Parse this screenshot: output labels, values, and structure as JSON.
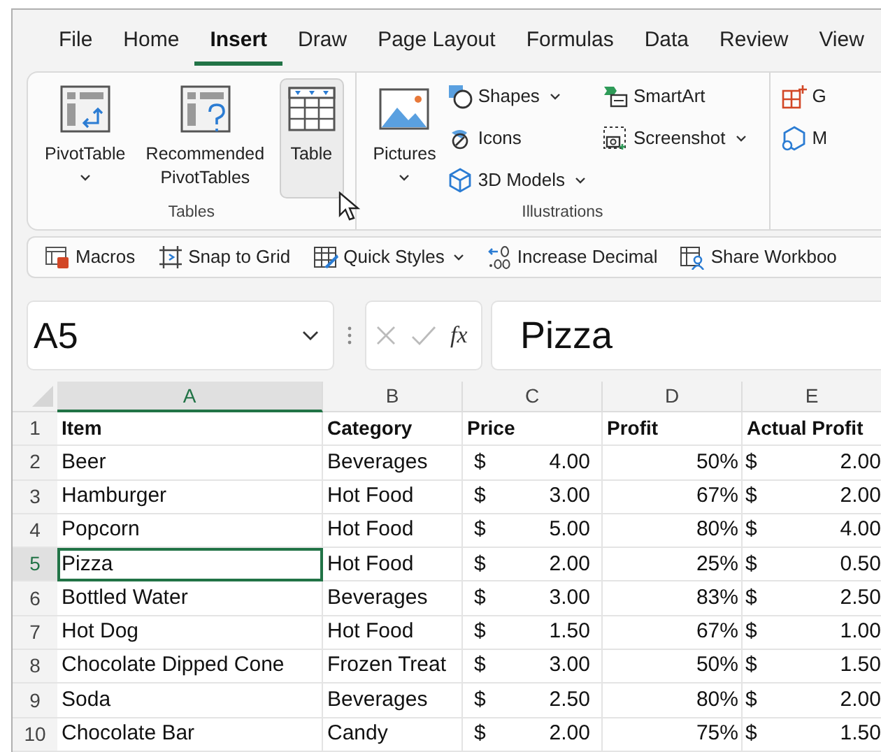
{
  "tabs": [
    {
      "label": "File",
      "selected": false
    },
    {
      "label": "Home",
      "selected": false
    },
    {
      "label": "Insert",
      "selected": true
    },
    {
      "label": "Draw",
      "selected": false
    },
    {
      "label": "Page Layout",
      "selected": false
    },
    {
      "label": "Formulas",
      "selected": false
    },
    {
      "label": "Data",
      "selected": false
    },
    {
      "label": "Review",
      "selected": false
    },
    {
      "label": "View",
      "selected": false
    }
  ],
  "ribbon": {
    "groups": [
      {
        "label": "Tables",
        "items": [
          {
            "kind": "large",
            "label": "PivotTable",
            "dropdown": true,
            "highlighted": false
          },
          {
            "kind": "large",
            "label": "Recommended PivotTables",
            "dropdown": false,
            "highlighted": false
          },
          {
            "kind": "large",
            "label": "Table",
            "dropdown": false,
            "highlighted": true
          }
        ]
      },
      {
        "label": "Illustrations",
        "items": [
          {
            "kind": "large",
            "label": "Pictures",
            "dropdown": true,
            "highlighted": false
          },
          {
            "kind": "stack",
            "items": [
              {
                "label": "Shapes",
                "dropdown": true
              },
              {
                "label": "Icons",
                "dropdown": false
              },
              {
                "label": "3D Models",
                "dropdown": true
              }
            ]
          },
          {
            "kind": "stack",
            "items": [
              {
                "label": "SmartArt",
                "dropdown": false
              },
              {
                "label": "Screenshot",
                "dropdown": true
              }
            ]
          }
        ]
      },
      {
        "items": [
          {
            "kind": "stack",
            "items": [
              {
                "label": "G",
                "dropdown": false
              },
              {
                "label": "M",
                "dropdown": false
              }
            ]
          }
        ]
      }
    ]
  },
  "quick_toolbar": [
    {
      "label": "Macros",
      "dropdown": false
    },
    {
      "label": "Snap to Grid",
      "dropdown": false
    },
    {
      "label": "Quick Styles",
      "dropdown": true
    },
    {
      "label": "Increase Decimal",
      "dropdown": false
    },
    {
      "label": "Share Workboo",
      "dropdown": false
    }
  ],
  "formula_bar": {
    "name_box": "A5",
    "function_label": "fx",
    "value": "Pizza"
  },
  "sheet": {
    "columns": [
      {
        "label": "A",
        "selected": true
      },
      {
        "label": "B",
        "selected": false
      },
      {
        "label": "C",
        "selected": false
      },
      {
        "label": "D",
        "selected": false
      },
      {
        "label": "E",
        "selected": false
      }
    ],
    "rows": [
      {
        "number": "1",
        "kind": "header",
        "selected": false,
        "cells": [
          "Item",
          "Category",
          "Price",
          "Profit",
          "Actual Profit"
        ]
      },
      {
        "number": "2",
        "kind": "data",
        "selected": false,
        "item": "Beer",
        "category": "Beverages",
        "price": {
          "currency": "$",
          "amount": "4.00"
        },
        "profit": "50%",
        "actual_profit": {
          "currency": "$",
          "amount": "2.00"
        }
      },
      {
        "number": "3",
        "kind": "data",
        "selected": false,
        "item": "Hamburger",
        "category": "Hot Food",
        "price": {
          "currency": "$",
          "amount": "3.00"
        },
        "profit": "67%",
        "actual_profit": {
          "currency": "$",
          "amount": "2.00"
        }
      },
      {
        "number": "4",
        "kind": "data",
        "selected": false,
        "item": "Popcorn",
        "category": "Hot Food",
        "price": {
          "currency": "$",
          "amount": "5.00"
        },
        "profit": "80%",
        "actual_profit": {
          "currency": "$",
          "amount": "4.00"
        }
      },
      {
        "number": "5",
        "kind": "data",
        "selected": true,
        "item": "Pizza",
        "category": "Hot Food",
        "price": {
          "currency": "$",
          "amount": "2.00"
        },
        "profit": "25%",
        "actual_profit": {
          "currency": "$",
          "amount": "0.50"
        }
      },
      {
        "number": "6",
        "kind": "data",
        "selected": false,
        "item": "Bottled Water",
        "category": "Beverages",
        "price": {
          "currency": "$",
          "amount": "3.00"
        },
        "profit": "83%",
        "actual_profit": {
          "currency": "$",
          "amount": "2.50"
        }
      },
      {
        "number": "7",
        "kind": "data",
        "selected": false,
        "item": "Hot Dog",
        "category": "Hot Food",
        "price": {
          "currency": "$",
          "amount": "1.50"
        },
        "profit": "67%",
        "actual_profit": {
          "currency": "$",
          "amount": "1.00"
        }
      },
      {
        "number": "8",
        "kind": "data",
        "selected": false,
        "item": "Chocolate Dipped Cone",
        "category": "Frozen Treat",
        "price": {
          "currency": "$",
          "amount": "3.00"
        },
        "profit": "50%",
        "actual_profit": {
          "currency": "$",
          "amount": "1.50"
        }
      },
      {
        "number": "9",
        "kind": "data",
        "selected": false,
        "item": "Soda",
        "category": "Beverages",
        "price": {
          "currency": "$",
          "amount": "2.50"
        },
        "profit": "80%",
        "actual_profit": {
          "currency": "$",
          "amount": "2.00"
        }
      },
      {
        "number": "10",
        "kind": "data",
        "selected": false,
        "item": "Chocolate Bar",
        "category": "Candy",
        "price": {
          "currency": "$",
          "amount": "2.00"
        },
        "profit": "75%",
        "actual_profit": {
          "currency": "$",
          "amount": "1.50"
        }
      }
    ]
  }
}
